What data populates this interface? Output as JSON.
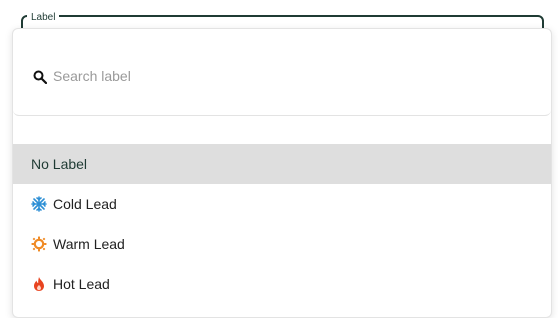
{
  "field": {
    "legend": "Label"
  },
  "search": {
    "icon": "search-icon",
    "placeholder": "Search label",
    "value": ""
  },
  "options": [
    {
      "label": "No Label",
      "icon": "",
      "selected": true
    },
    {
      "label": "Cold Lead",
      "icon": "snowflake-icon",
      "color": "#2d8fd5"
    },
    {
      "label": "Warm Lead",
      "icon": "sun-icon",
      "color": "#f08a24"
    },
    {
      "label": "Hot Lead",
      "icon": "fire-icon",
      "color": "#e8431f"
    }
  ],
  "colors": {
    "accent": "#1f3b34",
    "selected_bg": "#dedede"
  }
}
